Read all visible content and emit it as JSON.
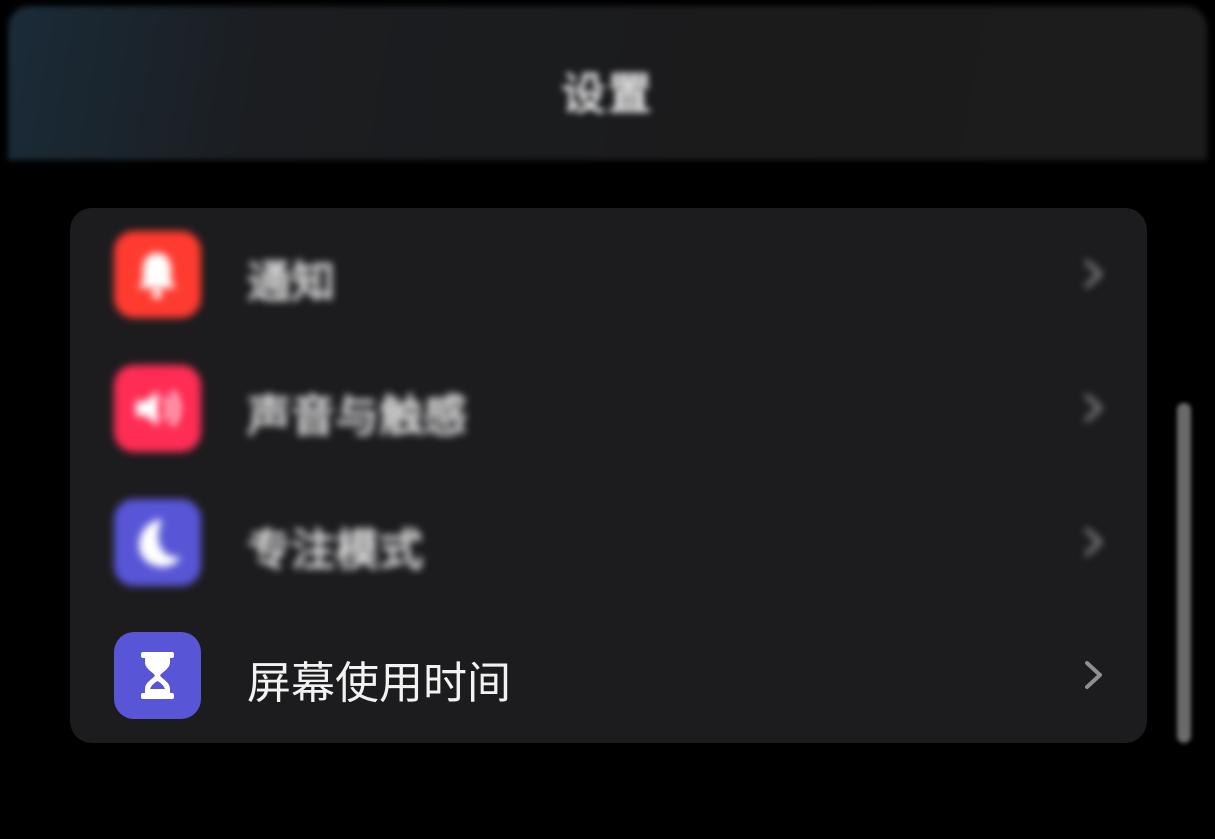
{
  "nav": {
    "title": "设置"
  },
  "settings": {
    "items": [
      {
        "label": "通知",
        "icon": "bell-icon",
        "color": "#ff3b30"
      },
      {
        "label": "声音与触感",
        "icon": "speaker-icon",
        "color": "#ff2d55"
      },
      {
        "label": "专注模式",
        "icon": "moon-icon",
        "color": "#5856d6"
      },
      {
        "label": "屏幕使用时间",
        "icon": "hourglass-icon",
        "color": "#5856d6"
      }
    ]
  },
  "colors": {
    "background": "#000000",
    "group_background": "#1c1c1e",
    "chevron": "#8e8e93",
    "text": "#f2f2f2"
  }
}
